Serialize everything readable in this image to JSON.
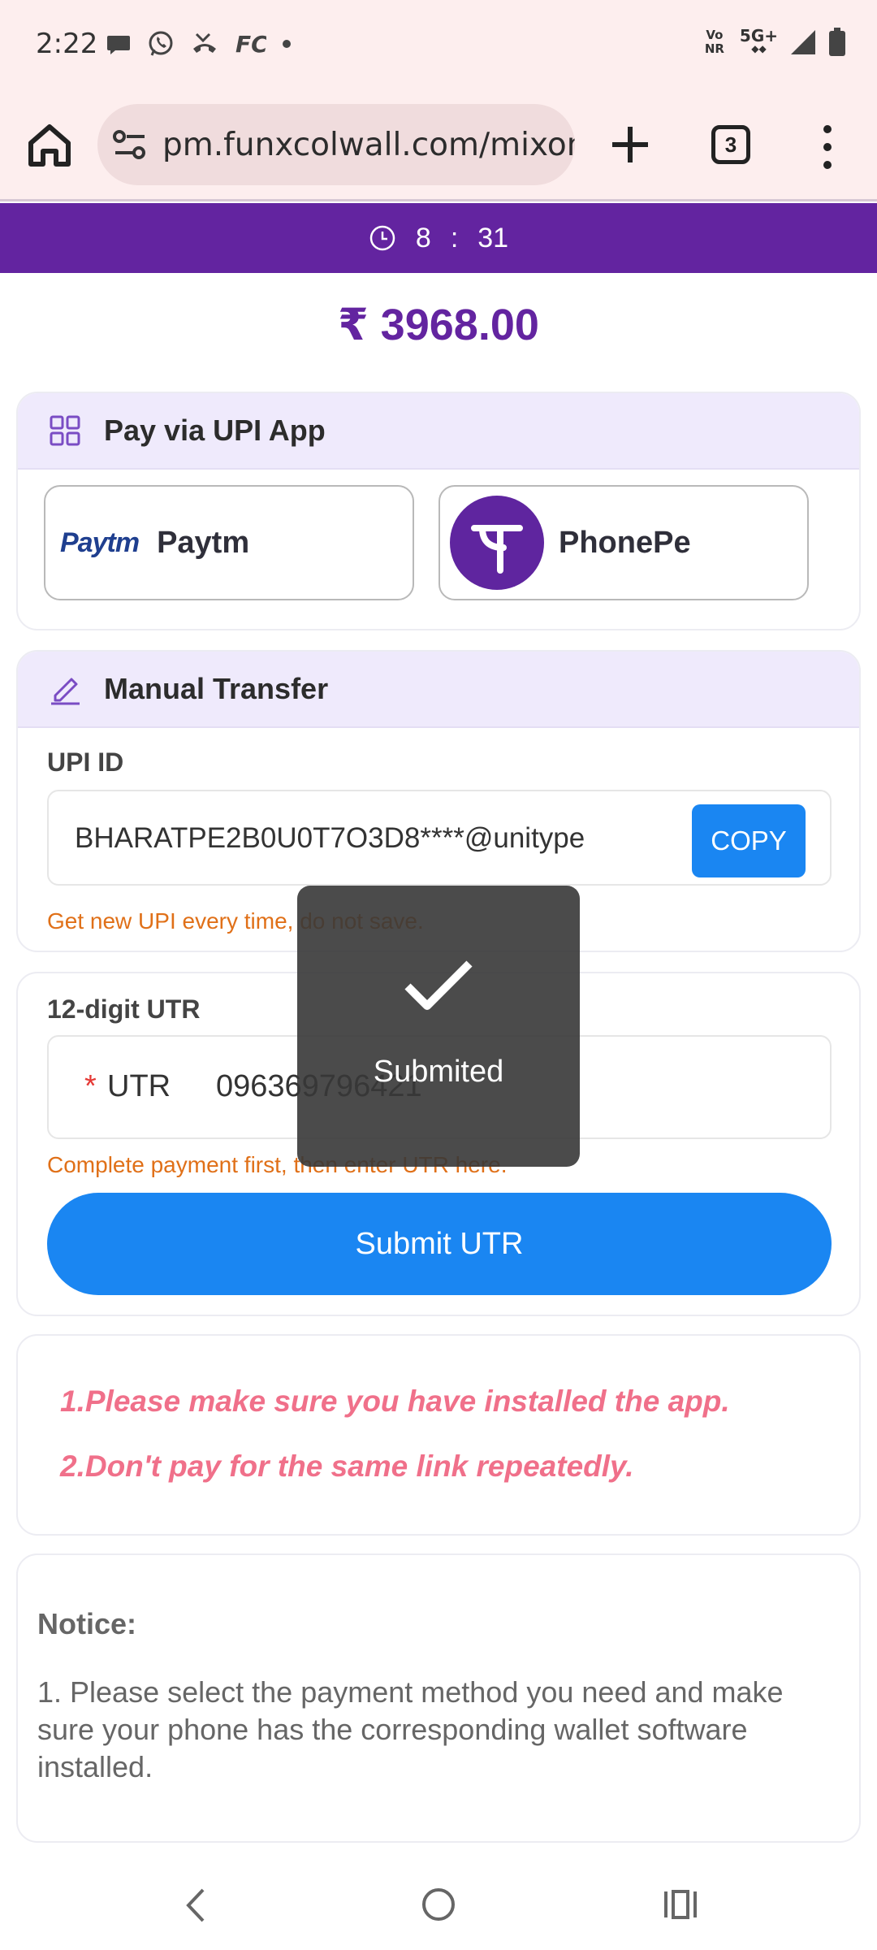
{
  "status_bar": {
    "time": "2:22",
    "notif_icons": [
      "chat-icon",
      "whatsapp-icon",
      "missed-call-icon",
      "fc-icon",
      "dot-icon"
    ],
    "fc_text": "FC",
    "network_volte": "Vo NR",
    "network_5g": "5G+",
    "signal_icon": "signal-icon",
    "battery_icon": "battery-icon"
  },
  "browser": {
    "url": "pm.funxcolwall.com/mixone",
    "tab_count": "3"
  },
  "timer": {
    "minutes": "8",
    "separator": ":",
    "seconds": "31"
  },
  "amount": "₹ 3968.00",
  "upi_app": {
    "title": "Pay via UPI App",
    "paytm_logo": "Paytm",
    "paytm_label": "Paytm",
    "phonepe_label": "PhonePe"
  },
  "manual": {
    "title": "Manual Transfer",
    "upi_label": "UPI ID",
    "upi_value": "BHARATPE2B0U0T7O3D8****@unitype",
    "copy_label": "COPY",
    "upi_hint": "Get new UPI every time, do not save."
  },
  "utr": {
    "label": "12-digit UTR",
    "required_mark": "*",
    "field_label": "UTR",
    "value": "096369796421",
    "hint": "Complete payment first, then enter UTR here.",
    "submit_label": "Submit UTR"
  },
  "tips": {
    "line1": "1.Please make sure you have installed the app.",
    "line2": "2.Don't pay for the same link repeatedly."
  },
  "notice": {
    "title": "Notice:",
    "text": "1. Please select the payment method you need and make sure your phone has the corresponding wallet software installed."
  },
  "toast": {
    "text": "Submited"
  },
  "colors": {
    "primary_purple": "#6324a0",
    "primary_blue": "#1a86f2",
    "warning_orange": "#e07018",
    "tip_pink": "#f0708a"
  }
}
